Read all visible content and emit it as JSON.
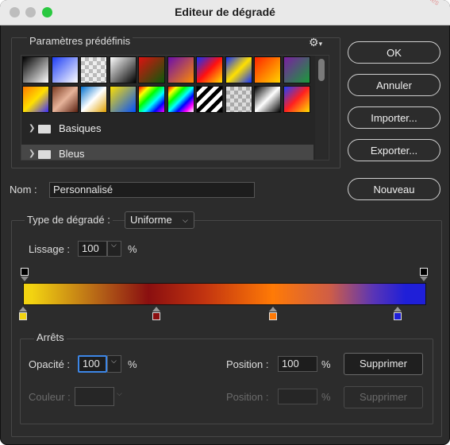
{
  "window": {
    "title": "Editeur de dégradé",
    "watermark": "01c6-4761-fc-4761-01c6 les"
  },
  "presets": {
    "label": "Paramètres prédéfinis",
    "swatches": [
      "linear-gradient(135deg,#000,#fff)",
      "linear-gradient(135deg,#1d3df5,#ffffff)",
      "repeating-conic-gradient(#bbb 0 25%,#eee 0 50%) 0 0/10px 10px",
      "linear-gradient(135deg,#fff,#000)",
      "linear-gradient(135deg,#d11,#0a5a0a)",
      "linear-gradient(135deg,#6a0dad,#ff8c00)",
      "linear-gradient(135deg,#1030ff,#ff1010,#ffe000)",
      "linear-gradient(135deg,#1030ff,#ffe000,#1030ff)",
      "linear-gradient(135deg,#ff2200,#ffd400)",
      "linear-gradient(135deg,#7a1fa2,#1a9b3a)",
      "linear-gradient(135deg,#ff7a00,#ffe000,#3a2cff)",
      "linear-gradient(135deg,#7a3a20,#e6b39a,#5a2010)",
      "linear-gradient(135deg,#0070d0,#ffffff,#e0a000)",
      "linear-gradient(135deg,#ffe000,#0050ff)",
      "linear-gradient(135deg,#ff0000,#ffff00,#00ff00,#00ffff,#0000ff,#ff00ff)",
      "linear-gradient(135deg,#ff0000,#ffff00,#00ff00,#00ffff,#0000ff,#ff00ff,#fff)",
      "repeating-linear-gradient(135deg,#000 0 5px,#fff 5px 10px)",
      "repeating-conic-gradient(#aaa 0 25%,#ddd 0 50%) 0 0/10px 10px",
      "linear-gradient(135deg,#000,#fff,#000)",
      "linear-gradient(135deg,#2040ff,#ff2020,#ffe000)",
      "linear-gradient(135deg,#ffffff,#444,#eee)"
    ],
    "folders": [
      "Basiques",
      "Bleus"
    ]
  },
  "name": {
    "label": "Nom :",
    "value": "Personnalisé"
  },
  "gradient_type": {
    "label": "Type de dégradé :",
    "value": "Uniforme"
  },
  "smoothness": {
    "label": "Lissage :",
    "value": "100",
    "unit": "%"
  },
  "gradient": {
    "opacity_stops": [
      0,
      100
    ],
    "color_stops": [
      {
        "location": 0,
        "color": "#f2d311"
      },
      {
        "location": 33,
        "color": "#8a0f10"
      },
      {
        "location": 62,
        "color": "#ff7a06"
      },
      {
        "location": 93,
        "color": "#1f1fd8"
      }
    ]
  },
  "stops": {
    "label": "Arrêts",
    "opacity_label": "Opacité :",
    "opacity_value": "100",
    "opacity_unit": "%",
    "position_label": "Position :",
    "position_value": "100",
    "position_unit": "%",
    "delete_label": "Supprimer",
    "color_label": "Couleur :",
    "position2_label": "Position :",
    "position2_value": "",
    "position2_unit": "%",
    "delete2_label": "Supprimer"
  },
  "buttons": {
    "ok": "OK",
    "cancel": "Annuler",
    "import": "Importer...",
    "export": "Exporter...",
    "new": "Nouveau"
  }
}
